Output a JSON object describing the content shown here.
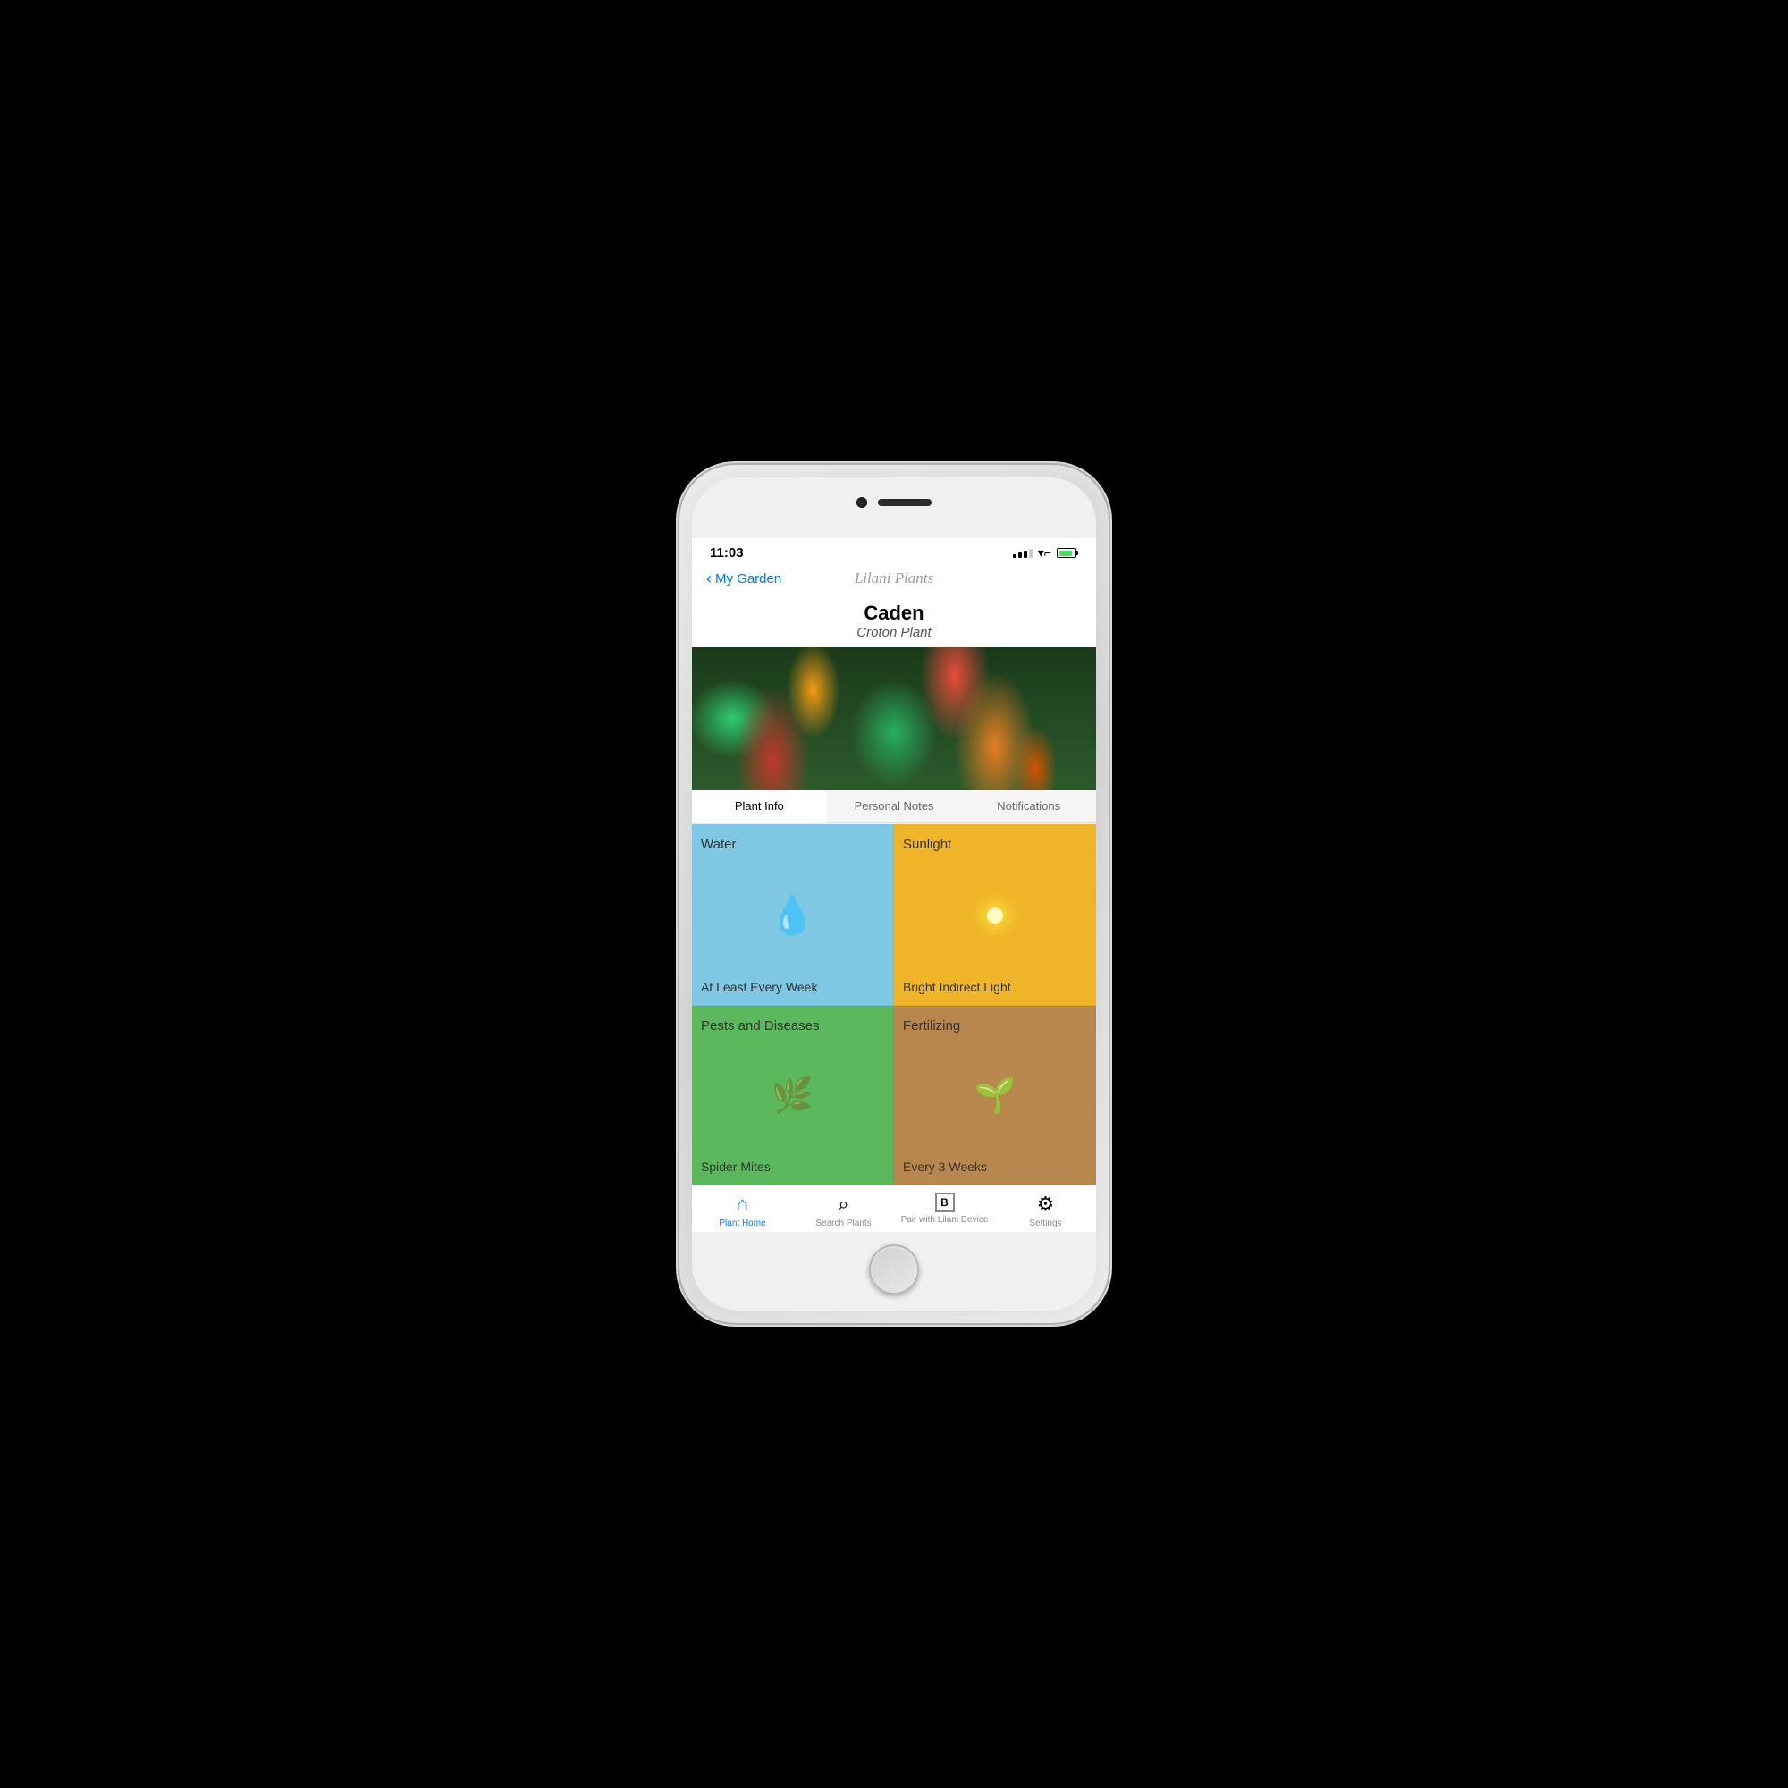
{
  "phone": {
    "status": {
      "time": "11:03",
      "signal_bars": [
        3,
        5,
        7,
        9,
        11
      ],
      "battery_label": "battery"
    },
    "nav": {
      "back_label": "My Garden",
      "app_title": "Lilani Plants"
    },
    "plant": {
      "name": "Caden",
      "species": "Croton Plant"
    },
    "tabs": [
      {
        "id": "plant-info",
        "label": "Plant Info",
        "active": true
      },
      {
        "id": "personal-notes",
        "label": "Personal Notes",
        "active": false
      },
      {
        "id": "notifications",
        "label": "Notifications",
        "active": false
      }
    ],
    "info_cells": [
      {
        "id": "water",
        "label": "Water",
        "value": "At Least Every Week",
        "icon": "water",
        "bg_color": "#7ec8e3"
      },
      {
        "id": "sunlight",
        "label": "Sunlight",
        "value": "Bright Indirect Light",
        "icon": "sun",
        "bg_color": "#f0b429"
      },
      {
        "id": "pests",
        "label": "Pests and Diseases",
        "value": "Spider Mites",
        "icon": "bug",
        "bg_color": "#5cb85c"
      },
      {
        "id": "fertilizing",
        "label": "Fertilizing",
        "value": "Every 3 Weeks",
        "icon": "seedling",
        "bg_color": "#b8874e"
      }
    ],
    "bottom_tabs": [
      {
        "id": "plant-home",
        "label": "Plant Home",
        "icon": "🏠",
        "active": true
      },
      {
        "id": "search-plants",
        "label": "Search Plants",
        "icon": "🔍",
        "active": false
      },
      {
        "id": "pair-device",
        "label": "Pair with Lilani Device",
        "icon": "Ⓑ",
        "active": false
      },
      {
        "id": "settings",
        "label": "Settings",
        "icon": "⚙️",
        "active": false
      }
    ]
  }
}
